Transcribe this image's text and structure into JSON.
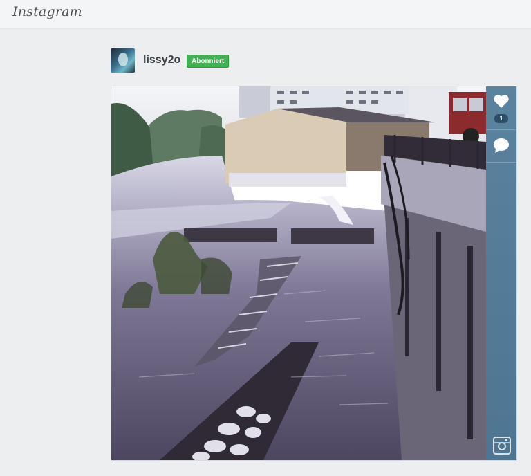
{
  "header": {
    "logo_text": "Instagram"
  },
  "post": {
    "username": "lissy2o",
    "follow_status": "Abonniert",
    "likes": "1"
  },
  "icons": {
    "like": "heart-icon",
    "comment": "comment-icon",
    "platform": "instagram-icon"
  },
  "colors": {
    "follow_badge": "#3fb34f",
    "action_bar": "#557b96",
    "topbar": "#f4f5f6",
    "background": "#eceeef"
  }
}
